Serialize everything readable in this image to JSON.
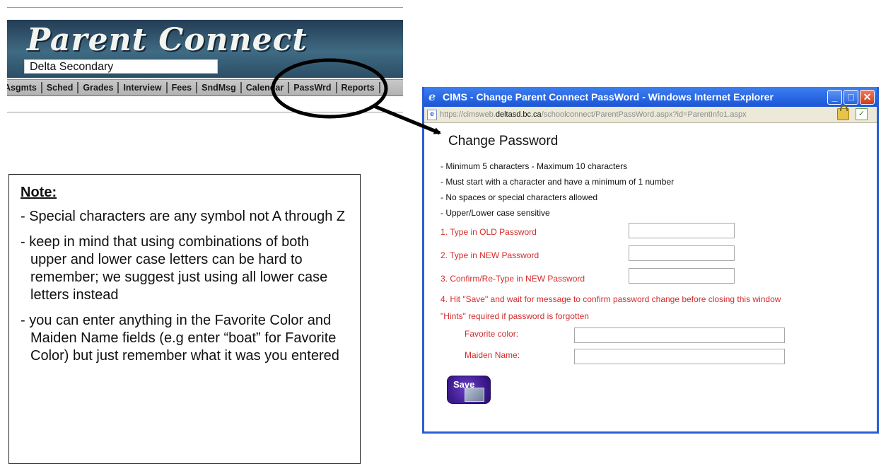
{
  "parent_connect": {
    "title": "Parent Connect",
    "school": "Delta Secondary",
    "tabs": [
      "Asgmts",
      "Sched",
      "Grades",
      "Interview",
      "Fees",
      "SndMsg",
      "Calendar",
      "PassWrd",
      "Reports"
    ]
  },
  "note": {
    "title": "Note:",
    "items": [
      "- Special characters are any symbol not A through Z",
      "- keep in mind that using combinations of both upper and lower case letters can be hard to remember; we suggest just using all lower case letters instead",
      "- you can enter anything in the Favorite Color and Maiden Name fields (e.g enter “boat” for Favorite Color) but just remember what it was you entered"
    ]
  },
  "window": {
    "title": "CIMS - Change Parent Connect PassWord - Windows Internet Explorer",
    "url_prefix": "https://cimsweb.",
    "url_domain": "deltasd.bc.ca",
    "url_path": "/schoolconnect/ParentPassWord.aspx?id=ParentInfo1.aspx",
    "heading": "Change Password",
    "rules": [
      "- Minimum 5 characters - Maximum 10 characters",
      "- Must start with a character and have a minimum of 1 number",
      "- No spaces or special characters allowed",
      "- Upper/Lower case sensitive"
    ],
    "step1": "1. Type in OLD Password",
    "step2": "2. Type in NEW Password",
    "step3": "3. Confirm/Re-Type in NEW Password",
    "step4": "4. Hit \"Save\" and wait for message to confirm password change before closing this window",
    "hints": "\"Hints\" required if password is forgotten",
    "favorite_color_label": "Favorite color:",
    "maiden_name_label": "Maiden Name:",
    "save_label": "Save",
    "old_password_value": "",
    "new_password_value": "",
    "confirm_password_value": "",
    "favorite_color_value": "",
    "maiden_name_value": ""
  },
  "colors": {
    "title_bar": "#1a55d6",
    "instruction_red": "#d42c2c",
    "save_button": "#3d1b8e"
  }
}
